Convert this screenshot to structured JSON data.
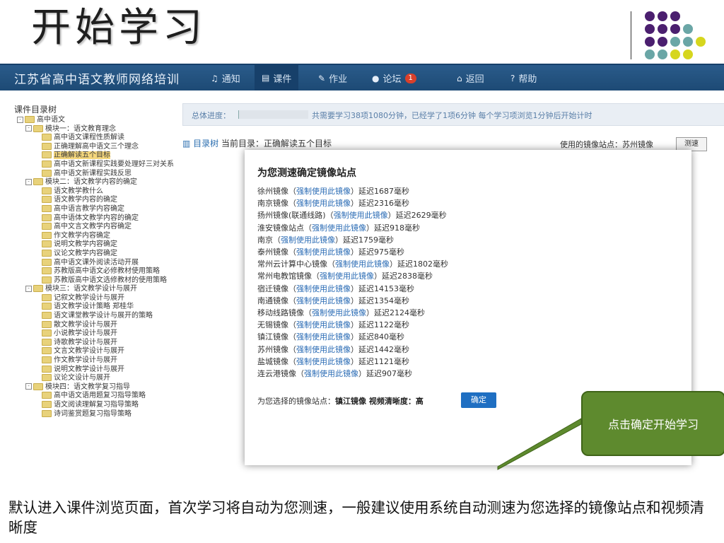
{
  "slide": {
    "title": "开始学习",
    "caption": "默认进入课件浏览页面，首次学习将自动为您测速，一般建议使用系统自动测速为您选择的镜像站点和视频清晰度",
    "callout": "点击确定开始学习",
    "colors": {
      "purple": "#4b1f6f",
      "teal": "#6aa6a6",
      "yellow": "#d6d61e",
      "callout": "#5e8a2e"
    }
  },
  "app": {
    "brand": "江苏省高中语文教师网络培训",
    "nav": [
      {
        "icon": "bell-icon",
        "glyph": "♫",
        "label": "通知"
      },
      {
        "icon": "film-icon",
        "glyph": "▤",
        "label": "课件"
      },
      {
        "icon": "pencil-icon",
        "glyph": "✎",
        "label": "作业"
      },
      {
        "icon": "comment-icon",
        "glyph": "●",
        "label": "论坛",
        "badge": "1"
      },
      {
        "icon": "home-icon",
        "glyph": "⌂",
        "label": "返回"
      },
      {
        "icon": "help-icon",
        "glyph": "?",
        "label": "帮助"
      }
    ]
  },
  "sidebar": {
    "heading": "课件目录树",
    "items": [
      {
        "label": "高中语文",
        "level": 0,
        "expander": "-"
      },
      {
        "label": "模块一：语文教育理念",
        "level": 1,
        "expander": "-"
      },
      {
        "label": "高中语文课程性质解读",
        "level": 2
      },
      {
        "label": "正确理解高中语文三个理念",
        "level": 2
      },
      {
        "label": "正确解读五个目标",
        "level": 2,
        "selected": true
      },
      {
        "label": "高中语文新课程实践要处理好三对关系",
        "level": 2
      },
      {
        "label": "高中语文新课程实践反思",
        "level": 2
      },
      {
        "label": "模块二：语文教学内容的确定",
        "level": 1,
        "expander": "-"
      },
      {
        "label": "语文教学教什么",
        "level": 2
      },
      {
        "label": "语文教学内容的确定",
        "level": 2
      },
      {
        "label": "高中语言教学内容确定",
        "level": 2
      },
      {
        "label": "高中语体文教学内容的确定",
        "level": 2
      },
      {
        "label": "高中文言文教学内容确定",
        "level": 2
      },
      {
        "label": "作文教学内容确定",
        "level": 2
      },
      {
        "label": "说明文教学内容确定",
        "level": 2
      },
      {
        "label": "议论文教学内容确定",
        "level": 2
      },
      {
        "label": "高中语文课外阅读活动开展",
        "level": 2
      },
      {
        "label": "苏教版高中语文必修教材使用策略",
        "level": 2
      },
      {
        "label": "苏教版高中语文选修教材的使用策略",
        "level": 2
      },
      {
        "label": "模块三：语文教学设计与展开",
        "level": 1,
        "expander": "-"
      },
      {
        "label": "记叙文教学设计与展开",
        "level": 2
      },
      {
        "label": "语文教学设计策略 郑桂华",
        "level": 2
      },
      {
        "label": "语文课堂教学设计与展开的策略",
        "level": 2
      },
      {
        "label": "散文教学设计与展开",
        "level": 2
      },
      {
        "label": "小说教学设计与展开",
        "level": 2
      },
      {
        "label": "诗歌教学设计与展开",
        "level": 2
      },
      {
        "label": "文言文教学设计与展开",
        "level": 2
      },
      {
        "label": "作文教学设计与展开",
        "level": 2
      },
      {
        "label": "说明文教学设计与展开",
        "level": 2
      },
      {
        "label": "议论文设计与展开",
        "level": 2
      },
      {
        "label": "模块四：语文教学复习指导",
        "level": 1,
        "expander": "-"
      },
      {
        "label": "高中语文语用题复习指导策略",
        "level": 2
      },
      {
        "label": "语文阅读理解复习指导策略",
        "level": 2
      },
      {
        "label": "诗词鉴赏题复习指导策略",
        "level": 2
      }
    ]
  },
  "progress": {
    "label": "总体进度：",
    "text": "共需要学习38项1080分钟，已经学了1项6分钟 每个学习项浏览1分钟后开始计时"
  },
  "breadcrumb": {
    "tree_link": "目录树",
    "current": "当前目录：正确解读五个目标"
  },
  "mirror": {
    "used": "使用的镜像站点：苏州镜像",
    "speed_button": "测速"
  },
  "modal": {
    "title": "为您测速确定镜像站点",
    "link_text": "强制使用此镜像",
    "prefix_open": "（",
    "prefix_close": "）延迟",
    "unit": "毫秒",
    "mirrors": [
      {
        "name": "徐州镜像",
        "delay": "1687"
      },
      {
        "name": "南京镜像",
        "delay": "2316"
      },
      {
        "name": "扬州镜像(联通线路)",
        "delay": "2629"
      },
      {
        "name": "淮安镜像站点",
        "delay": "918"
      },
      {
        "name": "南京",
        "delay": "1759"
      },
      {
        "name": "泰州镜像",
        "delay": "975"
      },
      {
        "name": "常州云计算中心镜像",
        "delay": "1802"
      },
      {
        "name": "常州电教馆镜像",
        "delay": "2838"
      },
      {
        "name": "宿迁镜像",
        "delay": "14153"
      },
      {
        "name": "南通镜像",
        "delay": "1354"
      },
      {
        "name": "移动线路镜像",
        "delay": "2124"
      },
      {
        "name": "无锡镜像",
        "delay": "1122"
      },
      {
        "name": "镇江镜像",
        "delay": "840"
      },
      {
        "name": "苏州镜像",
        "delay": "1442"
      },
      {
        "name": "盐城镜像",
        "delay": "1121"
      },
      {
        "name": "连云港镜像",
        "delay": "907"
      }
    ],
    "selection_label": "为您选择的镜像站点：",
    "selection_value": "镇江镜像 视频清晰度：高",
    "ok_button": "确定"
  }
}
